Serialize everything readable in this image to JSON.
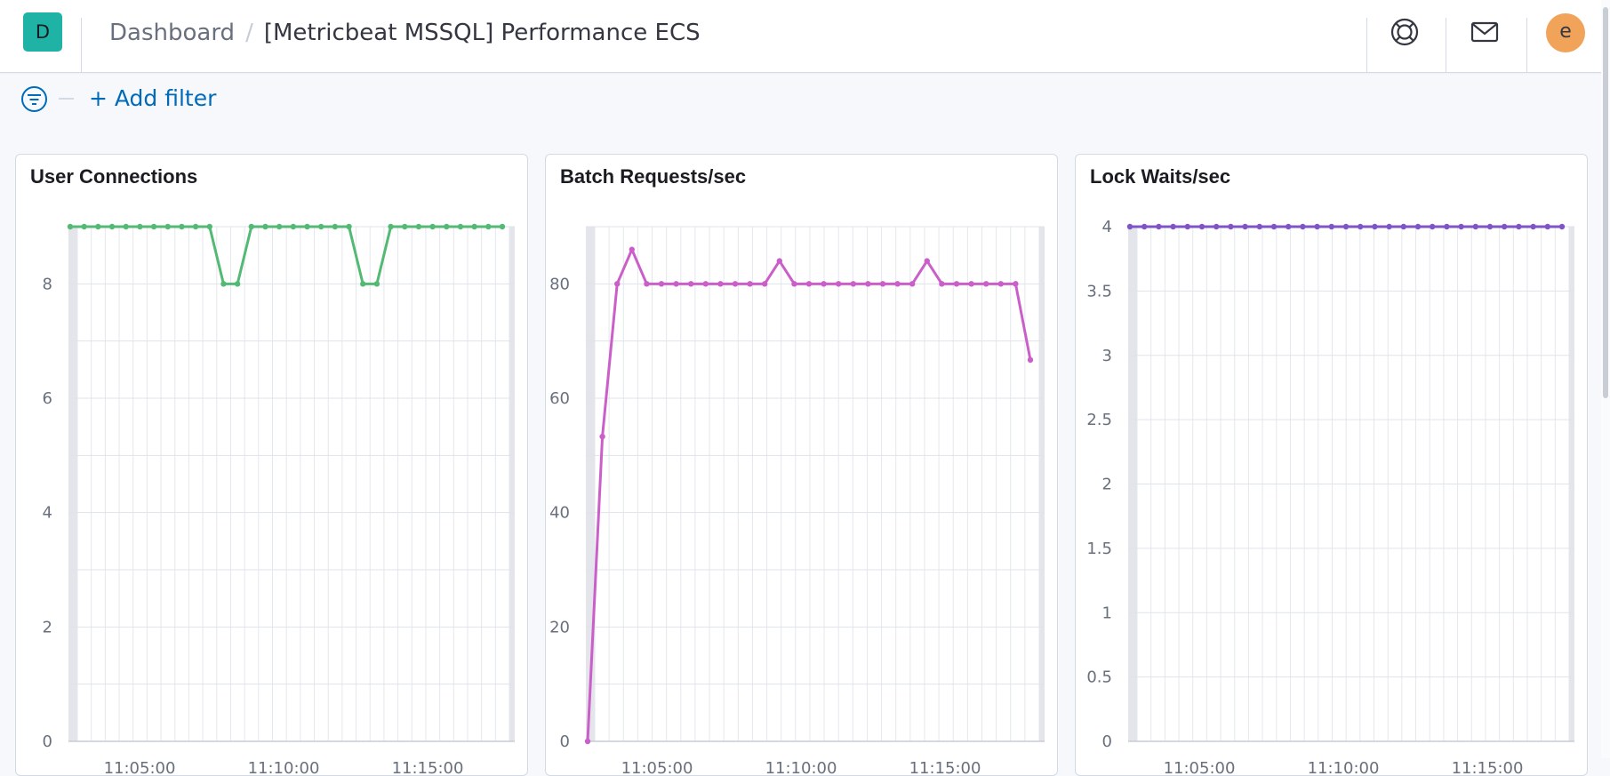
{
  "header": {
    "logo_letter": "D",
    "breadcrumbs": [
      "Dashboard",
      "[Metricbeat MSSQL] Performance ECS"
    ],
    "breadcrumb_separator": "/",
    "help_icon": "lifebuoy-icon",
    "mail_icon": "mail-icon",
    "avatar_letter": "e"
  },
  "filter_bar": {
    "filter_icon": "filter-icon",
    "add_filter_label": "+ Add filter"
  },
  "colors": {
    "accent": "#006bb8",
    "logo": "#1fb3a6",
    "avatar": "#f1a35a",
    "user_connections": "#54b974",
    "batch_requests": "#ca5fc9",
    "lock_waits": "#7f54c7"
  },
  "panels": [
    {
      "title": "User Connections",
      "y_ticks": [
        "0",
        "2",
        "4",
        "6",
        "8"
      ],
      "x_tick_labels": [
        "11:05:00",
        "11:10:00",
        "11:15:00"
      ]
    },
    {
      "title": "Batch Requests/sec",
      "y_ticks": [
        "0",
        "20",
        "40",
        "60",
        "80"
      ],
      "x_tick_labels": [
        "11:05:00",
        "11:10:00",
        "11:15:00"
      ]
    },
    {
      "title": "Lock Waits/sec",
      "y_ticks": [
        "0",
        "0.5",
        "1",
        "1.5",
        "2",
        "2.5",
        "3",
        "3.5",
        "4"
      ],
      "x_tick_labels": [
        "11:05:00",
        "11:10:00",
        "11:15:00"
      ]
    }
  ],
  "chart_data": [
    {
      "type": "line",
      "title": "User Connections",
      "xlabel": "",
      "ylabel": "",
      "ylim": [
        0,
        9
      ],
      "color": "#54b974",
      "series": [
        {
          "values": [
            9,
            9,
            9,
            9,
            9,
            9,
            9,
            9,
            9,
            9,
            9,
            8,
            8,
            9,
            9,
            9,
            9,
            9,
            9,
            9,
            9,
            8,
            8,
            9,
            9,
            9,
            9,
            9,
            9,
            9,
            9,
            9
          ]
        }
      ]
    },
    {
      "type": "line",
      "title": "Batch Requests/sec",
      "xlabel": "",
      "ylabel": "",
      "ylim": [
        0,
        90
      ],
      "color": "#ca5fc9",
      "series": [
        {
          "values": [
            0,
            53.3,
            80,
            86,
            80,
            80,
            80,
            80,
            80,
            80,
            80,
            80,
            80,
            84,
            80,
            80,
            80,
            80,
            80,
            80,
            80,
            80,
            80,
            84,
            80,
            80,
            80,
            80,
            80,
            80,
            66.7
          ]
        }
      ]
    },
    {
      "type": "line",
      "title": "Lock Waits/sec",
      "xlabel": "",
      "ylabel": "",
      "ylim": [
        0,
        4
      ],
      "color": "#7f54c7",
      "series": [
        {
          "values": [
            4,
            4,
            4,
            4,
            4,
            4,
            4,
            4,
            4,
            4,
            4,
            4,
            4,
            4,
            4,
            4,
            4,
            4,
            4,
            4,
            4,
            4,
            4,
            4,
            4,
            4,
            4,
            4,
            4,
            4,
            4
          ]
        }
      ]
    }
  ]
}
